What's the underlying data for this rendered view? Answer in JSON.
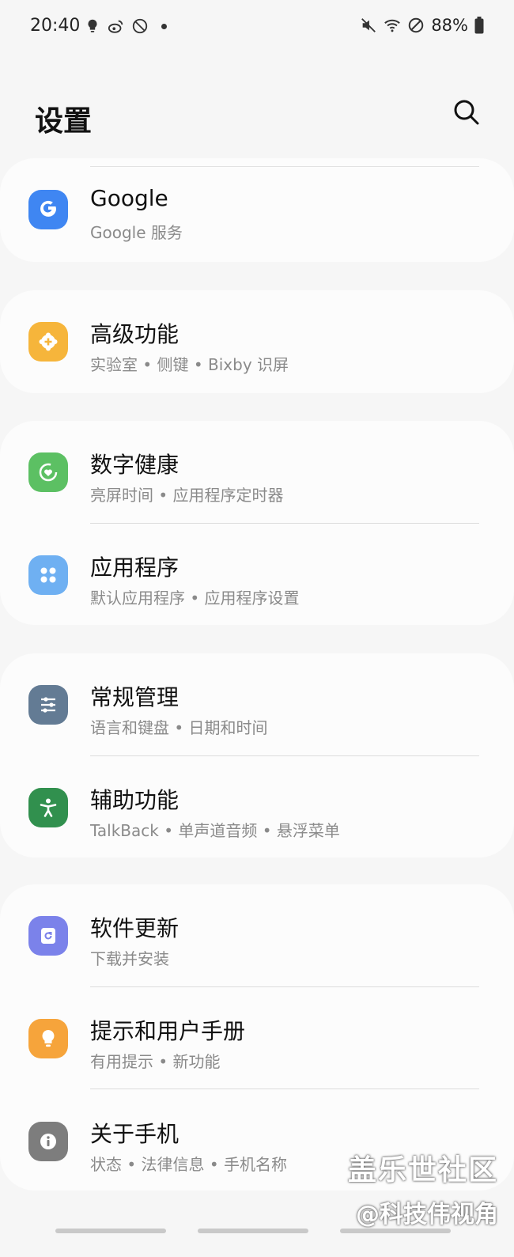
{
  "status_bar": {
    "time": "20:40",
    "left_icons": [
      "bulb-icon",
      "weibo-icon",
      "no-entry-icon"
    ],
    "right_icons": [
      "mute-icon",
      "wifi-icon",
      "block-icon"
    ],
    "battery": "88%"
  },
  "header": {
    "title": "设置",
    "search_icon": "search-icon"
  },
  "cards": [
    {
      "items": [
        {
          "title": "Google",
          "subtitle": "Google 服务",
          "icon": "google-icon",
          "color": "#3f86f2"
        }
      ]
    },
    {
      "items": [
        {
          "title": "高级功能",
          "subtitle": "实验室 • 侧键 • Bixby 识屏",
          "icon": "gear-plus-icon",
          "color": "#f6b53b"
        }
      ]
    },
    {
      "items": [
        {
          "title": "数字健康",
          "subtitle": "亮屏时间 • 应用程序定时器",
          "icon": "heart-ring-icon",
          "color": "#5cc063"
        },
        {
          "title": "应用程序",
          "subtitle": "默认应用程序 • 应用程序设置",
          "icon": "apps-grid-icon",
          "color": "#6fb0f2"
        }
      ]
    },
    {
      "items": [
        {
          "title": "常规管理",
          "subtitle": "语言和键盘 • 日期和时间",
          "icon": "sliders-icon",
          "color": "#637b94"
        },
        {
          "title": "辅助功能",
          "subtitle": "TalkBack • 单声道音频 • 悬浮菜单",
          "icon": "accessibility-icon",
          "color": "#31904e"
        }
      ]
    },
    {
      "items": [
        {
          "title": "软件更新",
          "subtitle": "下载并安装",
          "icon": "update-icon",
          "color": "#7b82ea"
        },
        {
          "title": "提示和用户手册",
          "subtitle": "有用提示 • 新功能",
          "icon": "lightbulb-icon",
          "color": "#f6a43b"
        },
        {
          "title": "关于手机",
          "subtitle": "状态 • 法律信息 • 手机名称",
          "icon": "info-icon",
          "color": "#7d7d7d"
        }
      ]
    }
  ],
  "watermark": {
    "line1": "盖乐世社区",
    "line2": "@科技伟视角"
  }
}
